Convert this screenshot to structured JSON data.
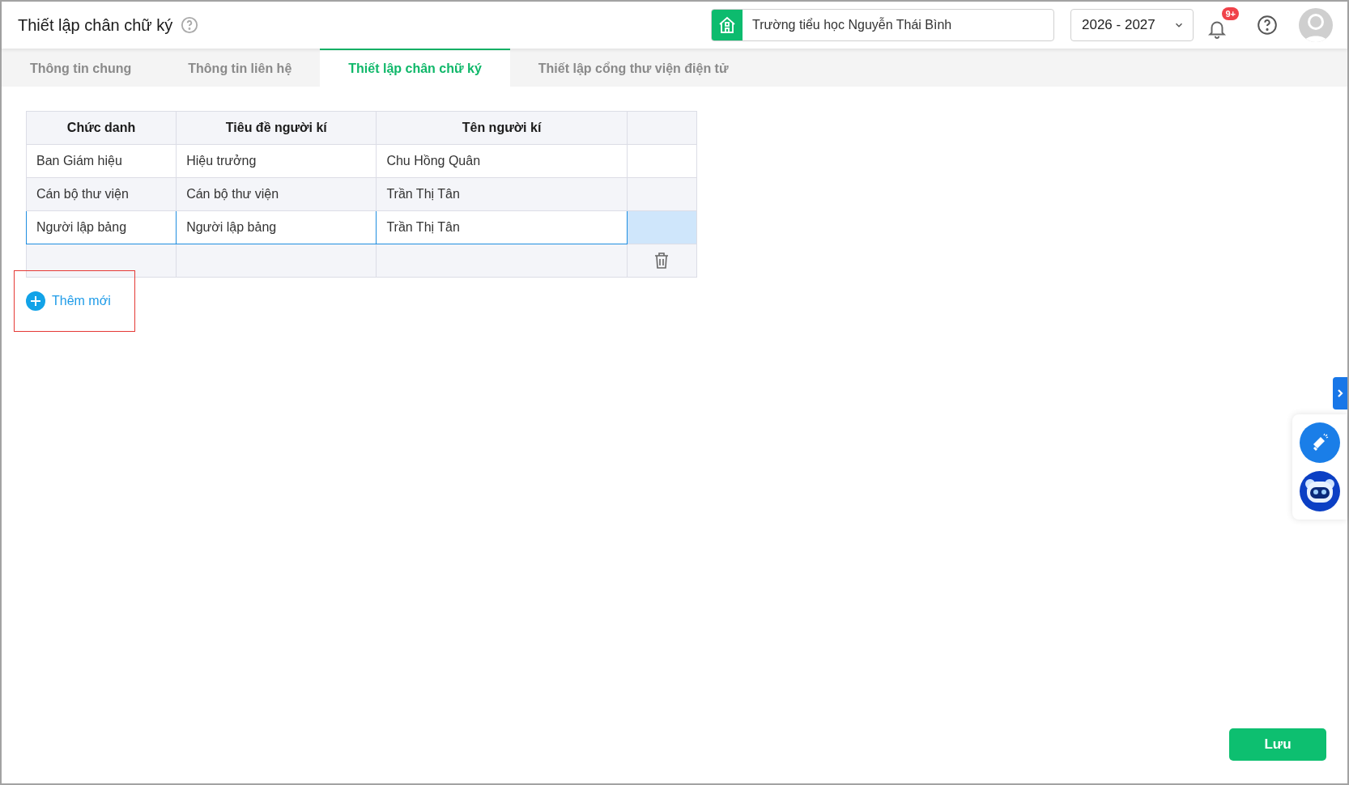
{
  "header": {
    "title": "Thiết lập chân chữ ký",
    "school": "Trường tiểu học Nguyễn Thái Bình",
    "year": "2026 - 2027",
    "notification_badge": "9+"
  },
  "tabs": [
    {
      "label": "Thông tin chung",
      "selected": false
    },
    {
      "label": "Thông tin liên hệ",
      "selected": false
    },
    {
      "label": "Thiết lập chân chữ ký",
      "selected": true
    },
    {
      "label": "Thiết lập cổng thư viện điện tử",
      "selected": false
    }
  ],
  "table": {
    "columns": [
      "Chức danh",
      "Tiêu đề người kí",
      "Tên người kí"
    ],
    "rows": [
      {
        "kind": "entry",
        "cells": [
          "Ban Giám hiệu",
          "Hiệu trưởng",
          "Chu Hồng Quân"
        ],
        "selected": false
      },
      {
        "kind": "entry",
        "cells": [
          "Cán bộ thư viện",
          "Cán bộ thư viện",
          "Trần Thị Tân"
        ],
        "selected": false
      },
      {
        "kind": "entry",
        "cells": [
          "Người lập bảng",
          "Người lập bảng",
          "Trần Thị Tân"
        ],
        "selected": true
      },
      {
        "kind": "blank",
        "cells": [],
        "selected": false
      }
    ]
  },
  "add_button": "Thêm mới",
  "save_button": "Lưu"
}
